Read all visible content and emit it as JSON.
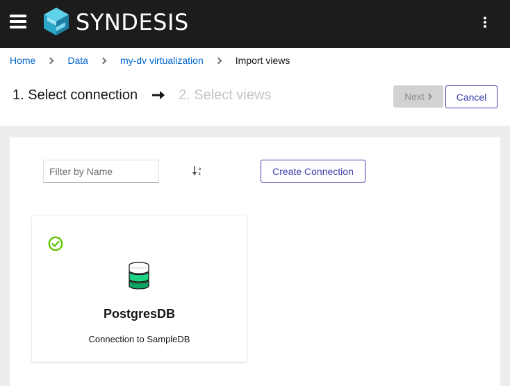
{
  "app": {
    "brand": "SYNDESIS",
    "accent_color": "#3c3fa8",
    "link_color": "#0066cc"
  },
  "breadcrumb": {
    "items": [
      {
        "label": "Home"
      },
      {
        "label": "Data"
      },
      {
        "label": "my-dv virtualization"
      }
    ],
    "current": "Import views"
  },
  "wizard": {
    "step1_label": "1. Select connection",
    "step2_label": "2. Select views",
    "next_label": "Next",
    "cancel_label": "Cancel"
  },
  "toolbar": {
    "filter_placeholder": "Filter by Name",
    "filter_value": "",
    "sort_icon": "sort-alpha-asc-icon",
    "create_label": "Create Connection"
  },
  "connections": [
    {
      "name": "PostgresDB",
      "description": "Connection to SampleDB",
      "selected": true,
      "icon": "database-icon",
      "status_color": "#5ec600"
    }
  ]
}
